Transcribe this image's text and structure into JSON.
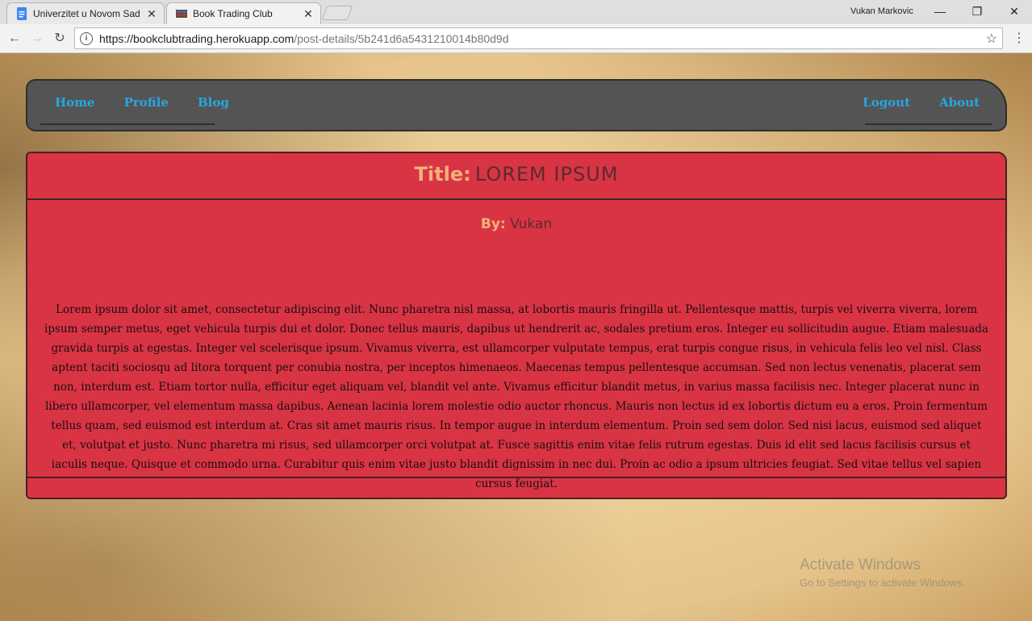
{
  "browser": {
    "tabs": [
      {
        "title": "Univerzitet u Novom Sad",
        "icon": "docs-icon"
      },
      {
        "title": "Book Trading Club",
        "icon": "book-icon"
      }
    ],
    "user_name": "Vukan Markovic",
    "url_host": "https://bookclubtrading.herokuapp.com",
    "url_path": "/post-details/5b241d6a5431210014b80d9d"
  },
  "nav": {
    "left": [
      "Home",
      "Profile",
      "Blog"
    ],
    "right": [
      "Logout",
      "About"
    ],
    "link_color": "#26a7e0"
  },
  "post": {
    "title_label": "Title:",
    "title": "LOREM IPSUM",
    "by_label": "By:",
    "author": "Vukan",
    "body": "Lorem ipsum dolor sit amet, consectetur adipiscing elit. Nunc pharetra nisl massa, at lobortis mauris fringilla ut. Pellentesque mattis, turpis vel viverra viverra, lorem ipsum semper metus, eget vehicula turpis dui et dolor. Donec tellus mauris, dapibus ut hendrerit ac, sodales pretium eros. Integer eu sollicitudin augue. Etiam malesuada gravida turpis at egestas. Integer vel scelerisque ipsum. Vivamus viverra, est ullamcorper vulputate tempus, erat turpis congue risus, in vehicula felis leo vel nisl. Class aptent taciti sociosqu ad litora torquent per conubia nostra, per inceptos himenaeos. Maecenas tempus pellentesque accumsan. Sed non lectus venenatis, placerat sem non, interdum est. Etiam tortor nulla, efficitur eget aliquam vel, blandit vel ante. Vivamus efficitur blandit metus, in varius massa facilisis nec. Integer placerat nunc in libero ullamcorper, vel elementum massa dapibus. Aenean lacinia lorem molestie odio auctor rhoncus. Mauris non lectus id ex lobortis dictum eu a eros. Proin fermentum tellus quam, sed euismod est interdum at. Cras sit amet mauris risus. In tempor augue in interdum elementum. Proin sed sem dolor. Sed nisi lacus, euismod sed aliquet et, volutpat et justo. Nunc pharetra mi risus, sed ullamcorper orci volutpat at. Fusce sagittis enim vitae felis rutrum egestas. Duis id elit sed lacus facilisis cursus et iaculis neque. Quisque et commodo urna. Curabitur quis enim vitae justo blandit dignissim in nec dui. Proin ac odio a ipsum ultricies feugiat. Sed vitae tellus vel sapien cursus feugiat.",
    "card_color": "#d93444"
  },
  "watermark": {
    "line1": "Activate Windows",
    "line2": "Go to Settings to activate Windows."
  }
}
